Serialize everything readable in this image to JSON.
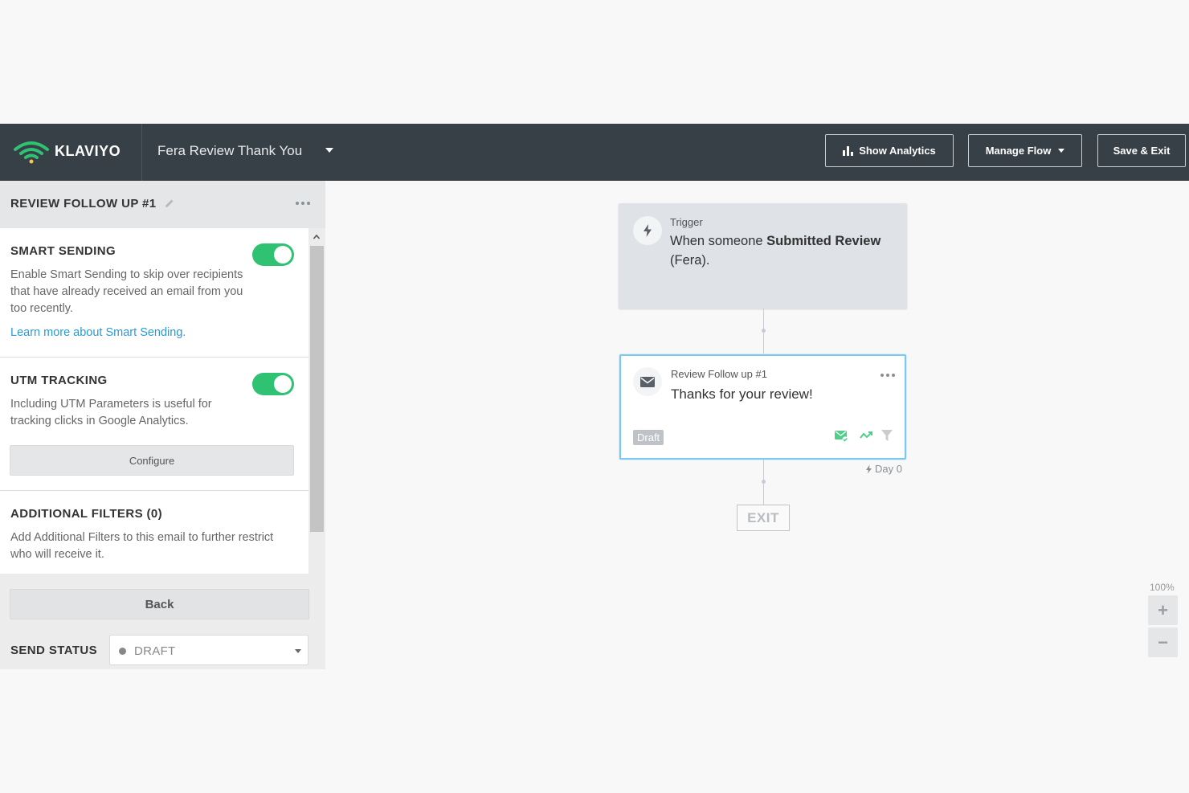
{
  "header": {
    "brand": "KLAVIYO",
    "flow_title": "Fera Review Thank You",
    "show_analytics_label": "Show Analytics",
    "manage_flow_label": "Manage Flow",
    "save_exit_label": "Save & Exit"
  },
  "panel": {
    "title": "REVIEW FOLLOW UP #1",
    "smart_sending": {
      "title": "SMART SENDING",
      "description": "Enable Smart Sending to skip over recipients that have already received an email from you too recently.",
      "link": "Learn more about Smart Sending.",
      "enabled": true
    },
    "utm_tracking": {
      "title": "UTM TRACKING",
      "description": "Including UTM Parameters is useful for tracking clicks in Google Analytics.",
      "configure_label": "Configure",
      "enabled": true
    },
    "additional_filters": {
      "title": "ADDITIONAL FILTERS (0)",
      "description": "Add Additional Filters to this email to further restrict who will receive it."
    },
    "back_label": "Back",
    "send_status_label": "SEND STATUS",
    "send_status_value": "DRAFT"
  },
  "canvas": {
    "trigger": {
      "label": "Trigger",
      "prefix": "When someone",
      "event": "Submitted Review",
      "suffix": "(Fera)."
    },
    "email": {
      "name": "Review Follow up #1",
      "subject": "Thanks for your review!",
      "status": "Draft",
      "delay": "Day 0"
    },
    "exit_label": "EXIT",
    "zoom": "100%",
    "zoom_in": "+",
    "zoom_out": "−"
  },
  "colors": {
    "topbar": "#373f47",
    "toggle_on": "#2ec272",
    "link": "#2a9bd6",
    "selected_border": "#7cc8ee"
  }
}
